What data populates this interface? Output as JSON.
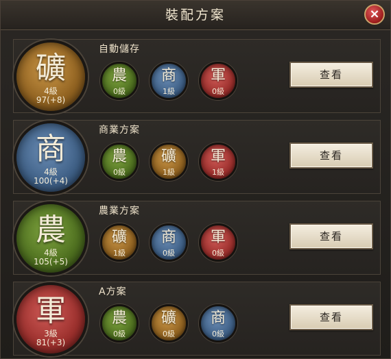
{
  "header": {
    "title": "裝配方案",
    "close_icon": "×"
  },
  "plans": [
    {
      "title": "自動儲存",
      "main": {
        "glyph": "礦",
        "level": "4級",
        "value": "97(+8)",
        "color": "kuang"
      },
      "slots": [
        {
          "glyph": "農",
          "level": "0級",
          "color": "nong"
        },
        {
          "glyph": "商",
          "level": "1級",
          "color": "shang"
        },
        {
          "glyph": "軍",
          "level": "0級",
          "color": "jun"
        }
      ],
      "button": "查看"
    },
    {
      "title": "商業方案",
      "main": {
        "glyph": "商",
        "level": "4級",
        "value": "100(+4)",
        "color": "shang"
      },
      "slots": [
        {
          "glyph": "農",
          "level": "0級",
          "color": "nong"
        },
        {
          "glyph": "礦",
          "level": "1級",
          "color": "kuang"
        },
        {
          "glyph": "軍",
          "level": "1級",
          "color": "jun"
        }
      ],
      "button": "查看"
    },
    {
      "title": "農業方案",
      "main": {
        "glyph": "農",
        "level": "4級",
        "value": "105(+5)",
        "color": "nong"
      },
      "slots": [
        {
          "glyph": "礦",
          "level": "1級",
          "color": "kuang"
        },
        {
          "glyph": "商",
          "level": "0級",
          "color": "shang"
        },
        {
          "glyph": "軍",
          "level": "0級",
          "color": "jun"
        }
      ],
      "button": "查看"
    },
    {
      "title": "A方案",
      "main": {
        "glyph": "軍",
        "level": "3級",
        "value": "81(+3)",
        "color": "jun"
      },
      "slots": [
        {
          "glyph": "農",
          "level": "0級",
          "color": "nong"
        },
        {
          "glyph": "礦",
          "level": "0級",
          "color": "kuang"
        },
        {
          "glyph": "商",
          "level": "0級",
          "color": "shang"
        }
      ],
      "button": "查看"
    }
  ]
}
